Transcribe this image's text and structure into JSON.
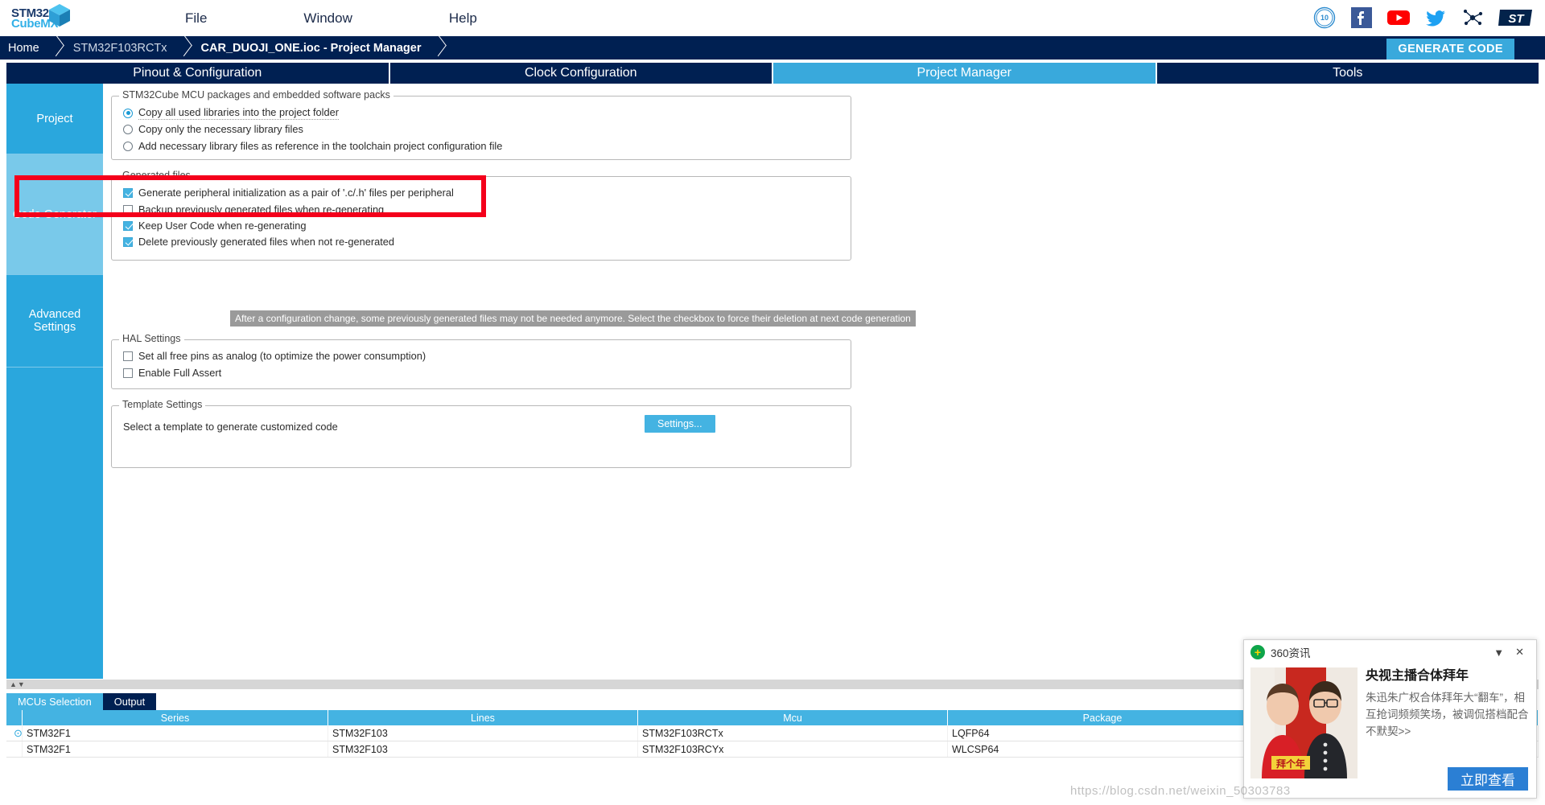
{
  "app": {
    "logo_primary": "STM32",
    "logo_secondary": "CubeMX",
    "menu": [
      "File",
      "Window",
      "Help"
    ],
    "social_icons": [
      "ten-years-badge-icon",
      "facebook-icon",
      "youtube-icon",
      "twitter-icon",
      "community-network-icon",
      "st-logo-icon"
    ]
  },
  "breadcrumb": {
    "home": "Home",
    "mcu": "STM32F103RCTx",
    "current": "CAR_DUOJI_ONE.ioc - Project Manager",
    "generate_code": "GENERATE CODE"
  },
  "tabs": [
    {
      "label": "Pinout & Configuration",
      "active": false
    },
    {
      "label": "Clock Configuration",
      "active": false
    },
    {
      "label": "Project Manager",
      "active": true
    },
    {
      "label": "Tools",
      "active": false
    }
  ],
  "sidebar": {
    "items": [
      {
        "label": "Project",
        "selected": false
      },
      {
        "label": "Code Generator",
        "selected": true
      },
      {
        "label": "Advanced Settings",
        "selected": false
      }
    ]
  },
  "groups": {
    "packages": {
      "title": "STM32Cube MCU packages and embedded software packs",
      "options": [
        {
          "label": "Copy all used libraries into the project folder",
          "checked": true,
          "focused": true
        },
        {
          "label": "Copy only the necessary library files",
          "checked": false,
          "focused": false
        },
        {
          "label": "Add necessary library files as reference in the toolchain project configuration file",
          "checked": false,
          "focused": false
        }
      ]
    },
    "generated_files": {
      "title": "Generated files",
      "options": [
        {
          "label": "Generate peripheral initialization as a pair of '.c/.h' files per peripheral",
          "checked": true
        },
        {
          "label": "Backup previously generated files when re-generating",
          "checked": false
        },
        {
          "label": "Keep User Code when re-generating",
          "checked": true
        },
        {
          "label": "Delete previously generated files when not re-generated",
          "checked": true
        }
      ],
      "tooltip": "After a configuration change, some previously generated files may not be needed anymore. Select the checkbox to force their deletion at next code generation"
    },
    "hal_settings": {
      "title": "HAL Settings",
      "options": [
        {
          "label": "Set all free pins as analog (to optimize the power consumption)",
          "checked": false
        },
        {
          "label": "Enable Full Assert",
          "checked": false
        }
      ]
    },
    "template_settings": {
      "title": "Template Settings",
      "description": "Select a template to generate customized code",
      "button": "Settings..."
    }
  },
  "bottom": {
    "tabs": [
      {
        "label": "MCUs Selection",
        "selected": true
      },
      {
        "label": "Output",
        "selected": false
      }
    ],
    "columns": [
      "Series",
      "Lines",
      "Mcu",
      "Package"
    ],
    "rows": [
      {
        "selected": true,
        "series": "STM32F1",
        "lines": "STM32F103",
        "mcu": "STM32F103RCTx",
        "package": "LQFP64"
      },
      {
        "selected": false,
        "series": "STM32F1",
        "lines": "STM32F103",
        "mcu": "STM32F103RCYx",
        "package": "WLCSP64"
      }
    ]
  },
  "popup": {
    "title": "360资讯",
    "collapse_icon": "chevron-down-icon",
    "close_icon": "close-icon",
    "headline": "央视主播合体拜年",
    "description": "朱迅朱广权合体拜年大“翻车”，相互抢词频频笑场，被调侃搭档配合不默契>>",
    "button": "立即查看"
  },
  "watermark": "https://blog.csdn.net/weixin_50303783",
  "colors": {
    "accent": "#44b3e2",
    "navy": "#002052",
    "annotation": "#f4001b",
    "sidebar": "#2aa7dd",
    "sidebar_selected": "#79c9ea"
  }
}
